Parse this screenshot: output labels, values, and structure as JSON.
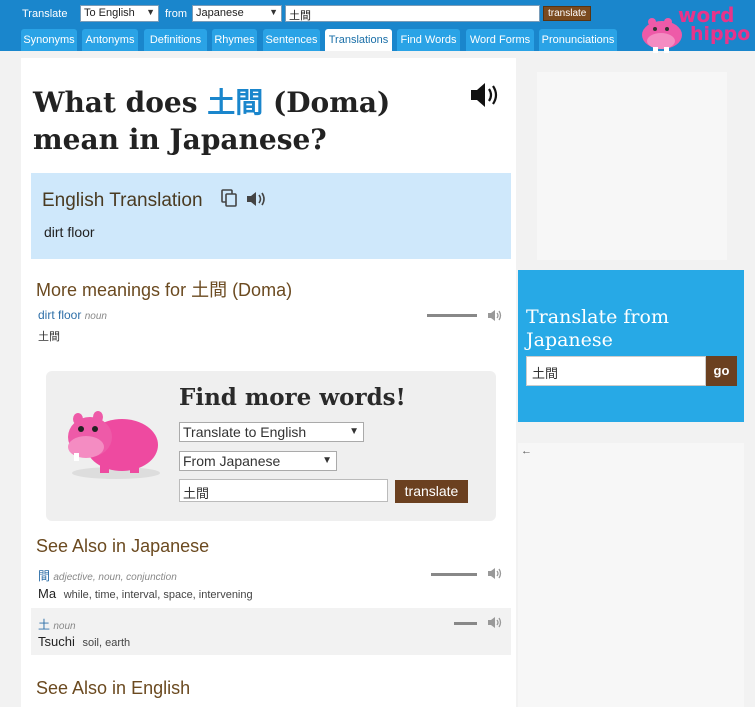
{
  "topbar": {
    "translate_label": "Translate",
    "to_select": "To English",
    "from_label": "from",
    "from_select": "Japanese",
    "search_value": "土間",
    "translate_button": "translate",
    "tabs": [
      "Synonyms",
      "Antonyms",
      "Definitions",
      "Rhymes",
      "Sentences",
      "Translations",
      "Find Words",
      "Word Forms",
      "Pronunciations"
    ],
    "active_tab": "Translations",
    "logo_word": "word",
    "logo_hippo": "hippo"
  },
  "heading": {
    "prefix": "What does ",
    "word": "土間",
    "suffix": " (Doma) mean in Japanese?"
  },
  "translation": {
    "title": "English Translation",
    "value": "dirt floor"
  },
  "more_meanings": {
    "title": "More meanings for 土間 (Doma)",
    "word": "dirt floor",
    "pos": "noun",
    "jp": "土間"
  },
  "find_more": {
    "title": "Find more words!",
    "select_to": "Translate to English",
    "select_from": "From Japanese",
    "input_value": "土間",
    "button": "translate"
  },
  "see_also_jp": {
    "title": "See Also in Japanese",
    "items": [
      {
        "jp": "間",
        "pos": "adjective, noun, conjunction",
        "romaji": "Ma",
        "gloss": "while, time, interval, space, intervening"
      },
      {
        "jp": "土",
        "pos": "noun",
        "romaji": "Tsuchi",
        "gloss": "soil, earth"
      }
    ]
  },
  "see_also_en": {
    "title": "See Also in English"
  },
  "sidebar": {
    "title": "Translate from Japanese",
    "input_value": "土間",
    "button": "go"
  },
  "icons": {
    "speaker": "speaker-icon",
    "copy": "copy-icon",
    "hippo": "hippo-icon",
    "back_arrow": "back-arrow-icon"
  },
  "colors": {
    "brand_blue": "#1a86cc",
    "tab_blue": "#2aa3e6",
    "brown": "#6b4020",
    "pink": "#e8348a"
  }
}
